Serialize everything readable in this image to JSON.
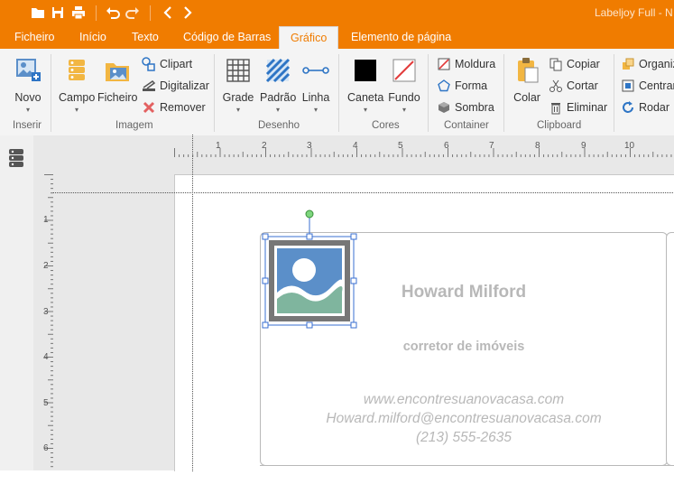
{
  "app": {
    "title": "Labeljoy Full - N",
    "accent_color": "#f07c00"
  },
  "quick_access": {
    "icons": [
      "open-folder-icon",
      "save-icon",
      "print-icon",
      "undo-icon",
      "redo-icon",
      "back-icon",
      "forward-icon"
    ]
  },
  "tabs": [
    {
      "label": "Ficheiro",
      "active": false
    },
    {
      "label": "Início",
      "active": false
    },
    {
      "label": "Texto",
      "active": false
    },
    {
      "label": "Código de Barras",
      "active": false
    },
    {
      "label": "Gráfico",
      "active": true
    },
    {
      "label": "Elemento de página",
      "active": false
    }
  ],
  "ribbon": {
    "inserir": {
      "group": "Inserir",
      "novo": "Novo"
    },
    "imagem": {
      "group": "Imagem",
      "campo": "Campo",
      "ficheiro": "Ficheiro",
      "clipart": "Clipart",
      "digitalizar": "Digitalizar",
      "remover": "Remover"
    },
    "desenho": {
      "group": "Desenho",
      "grade": "Grade",
      "padrao": "Padrão",
      "linha": "Linha"
    },
    "cores": {
      "group": "Cores",
      "caneta": "Caneta",
      "fundo": "Fundo"
    },
    "container": {
      "group": "Container",
      "moldura": "Moldura",
      "forma": "Forma",
      "sombra": "Sombra"
    },
    "clipboard": {
      "group": "Clipboard",
      "colar": "Colar",
      "copiar": "Copiar",
      "cortar": "Cortar",
      "eliminar": "Eliminar"
    },
    "arrange": {
      "organizar": "Organiz",
      "centrar": "Centrar",
      "rodar": "Rodar"
    }
  },
  "ruler": {
    "horizontal": [
      "1",
      "2",
      "3",
      "4",
      "5",
      "6",
      "7",
      "8",
      "9",
      "10"
    ],
    "vertical": [
      "1",
      "2",
      "3",
      "4",
      "5",
      "6"
    ]
  },
  "card": {
    "name": "Howard Milford",
    "role": "corretor de imóveis",
    "website": "www.encontresuanovacasa.com",
    "email": "Howard.milford@encontresuanovacasa.com",
    "phone": "(213) 555-2635"
  }
}
